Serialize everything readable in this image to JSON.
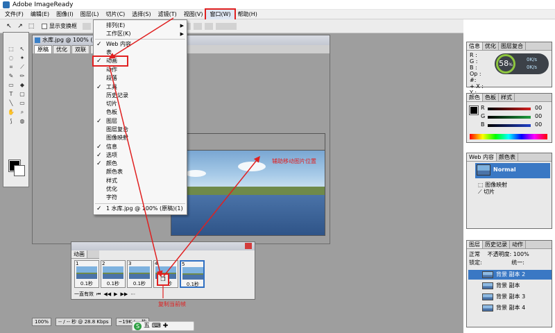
{
  "window": {
    "title": "Adobe ImageReady"
  },
  "menubar": [
    "文件(F)",
    "编辑(E)",
    "图像(I)",
    "图层(L)",
    "切片(C)",
    "选择(S)",
    "滤镜(T)",
    "视图(V)",
    "窗口(W)",
    "帮助(H)"
  ],
  "options": {
    "show_transform": "显示变换框"
  },
  "document": {
    "title": "水库.jpg @ 100% (原稿)",
    "tabs": [
      "原稿",
      "优化",
      "双联",
      "四联"
    ]
  },
  "window_menu": {
    "items": [
      {
        "label": "排列(E)",
        "checked": false,
        "submenu": true
      },
      {
        "label": "工作区(K)",
        "checked": false,
        "submenu": true
      },
      {
        "label": "Web 内容",
        "checked": true,
        "submenu": false
      },
      {
        "label": "表",
        "checked": false,
        "submenu": false
      },
      {
        "label": "动画",
        "checked": true,
        "submenu": false,
        "highlight": true
      },
      {
        "label": "动作",
        "checked": false,
        "submenu": false
      },
      {
        "label": "段落",
        "checked": false,
        "submenu": false
      },
      {
        "label": "工具",
        "checked": true,
        "submenu": false
      },
      {
        "label": "历史记录",
        "checked": false,
        "submenu": false
      },
      {
        "label": "切片",
        "checked": false,
        "submenu": false
      },
      {
        "label": "色板",
        "checked": false,
        "submenu": false
      },
      {
        "label": "图层",
        "checked": true,
        "submenu": false
      },
      {
        "label": "图层复合",
        "checked": false,
        "submenu": false
      },
      {
        "label": "图像映射",
        "checked": false,
        "submenu": false
      },
      {
        "label": "信息",
        "checked": true,
        "submenu": false
      },
      {
        "label": "选项",
        "checked": true,
        "submenu": false
      },
      {
        "label": "颜色",
        "checked": true,
        "submenu": false
      },
      {
        "label": "颜色表",
        "checked": false,
        "submenu": false
      },
      {
        "label": "样式",
        "checked": false,
        "submenu": false
      },
      {
        "label": "优化",
        "checked": false,
        "submenu": false
      },
      {
        "label": "字符",
        "checked": false,
        "submenu": false
      }
    ],
    "open_doc": "1 水库.jpg @ 100% (原稿)(1)"
  },
  "info_panel": {
    "tabs": [
      "信息",
      "优化",
      "图层复合"
    ],
    "rows": [
      "R :",
      "G :",
      "B :",
      "Op :",
      "#:",
      "+ X :",
      "Y :"
    ],
    "gauge_value": "58",
    "gauge_unit": "%",
    "speed_up": "0K/s",
    "speed_down": "0K/s"
  },
  "color_panel": {
    "tabs": [
      "颜色",
      "色板",
      "样式"
    ],
    "channels": [
      {
        "name": "R",
        "value": "00",
        "color": "#d42020"
      },
      {
        "name": "G",
        "value": "00",
        "color": "#20a040"
      },
      {
        "name": "B",
        "value": "00",
        "color": "#2040c8"
      }
    ]
  },
  "web_panel": {
    "tabs": [
      "Web 内容",
      "颜色表"
    ],
    "selected": "Normal",
    "items": [
      "图像映射",
      "切片"
    ]
  },
  "layers_panel": {
    "tabs": [
      "图层",
      "历史记录",
      "动作"
    ],
    "blend": "正常",
    "opacity_label": "不透明度:",
    "opacity_value": "100%",
    "lock_label": "锁定:",
    "unify_label": "统一:",
    "layers": [
      "背景 副本 2",
      "背景 副本",
      "背景 副本 3",
      "背景 副本 4"
    ]
  },
  "animation_panel": {
    "title": "动画",
    "frames": [
      {
        "num": "1",
        "delay": "0.1秒"
      },
      {
        "num": "2",
        "delay": "0.1秒"
      },
      {
        "num": "3",
        "delay": "0.1秒"
      },
      {
        "num": "4",
        "delay": "0.1秒"
      },
      {
        "num": "5",
        "delay": "0.1秒"
      }
    ],
    "loop": "一直有效"
  },
  "annotations": {
    "move_image": "辅助移动图片位置",
    "copy_frame": "复制当前帧"
  },
  "status": {
    "zoom": "100%",
    "speed": "-- / -- 秒 @ 28.8 Kbps",
    "size": "~19K / -- 秒"
  },
  "ime": {
    "label": "五"
  },
  "colors": {
    "accent_red": "#e02020",
    "select_blue": "#3a78c4"
  }
}
